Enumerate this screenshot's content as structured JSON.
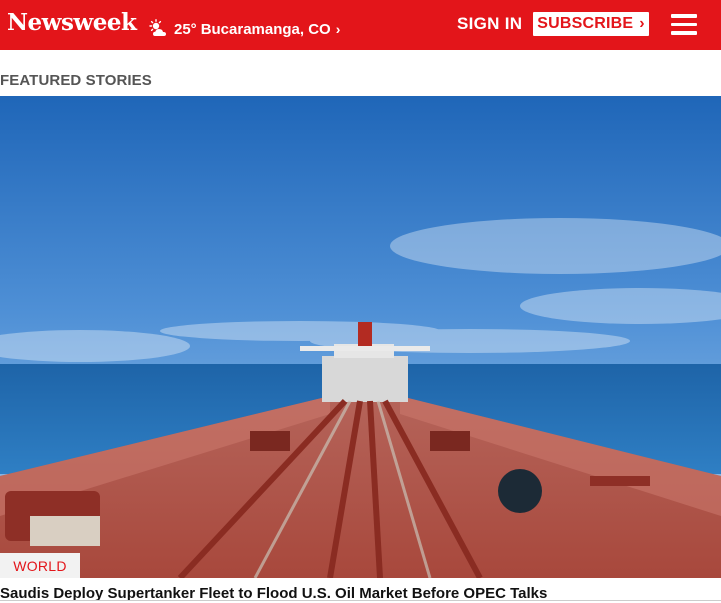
{
  "header": {
    "logo": "Newsweek",
    "weather": {
      "icon": "partly-cloudy-icon",
      "temperature": "25°",
      "location": "Bucaramanga, CO"
    },
    "sign_in": "SIGN IN",
    "subscribe": "SUBSCRIBE",
    "menu_icon": "hamburger-menu-icon"
  },
  "colors": {
    "brand_red": "#e3151a",
    "section_label": "#555555"
  },
  "featured": {
    "section_title": "FEATURED STORIES",
    "story": {
      "category": "WORLD",
      "headline": "Saudis Deploy Supertanker Fleet to Flood U.S. Oil Market Before OPEC Talks"
    }
  }
}
